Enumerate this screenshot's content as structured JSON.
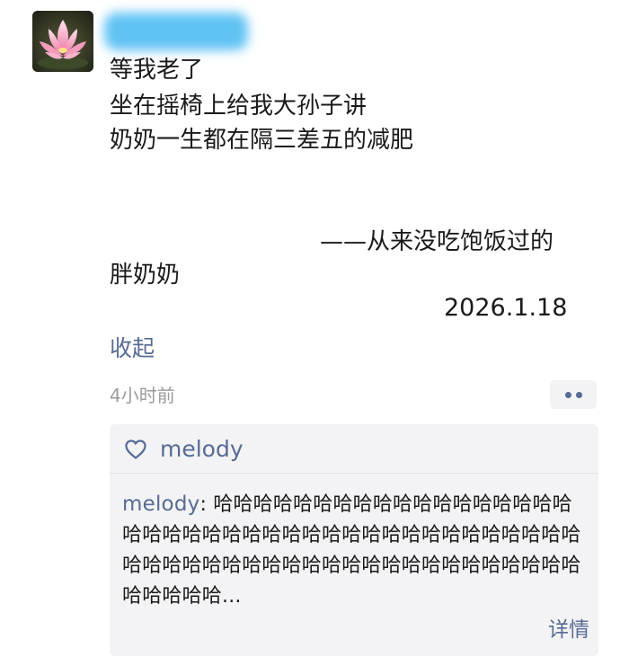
{
  "post": {
    "avatar_icon": "pink-lotus-flower",
    "username_redacted": true,
    "lines": [
      "等我老了",
      "坐在摇椅上给我大孙子讲",
      "奶奶一生都在隔三差五的减肥",
      "——从来没吃饱饭过的",
      "胖奶奶"
    ],
    "date": "2026.1.18",
    "collapse_label": "收起",
    "timestamp": "4小时前"
  },
  "more_button": {
    "icon": "two-dots-icon"
  },
  "interactions": {
    "like_icon": "heart-outline-icon",
    "liked_by": "melody",
    "comment": {
      "author": "melody",
      "separator": ": ",
      "text": "哈哈哈哈哈哈哈哈哈哈哈哈哈哈哈哈哈哈哈哈哈哈哈哈哈哈哈哈哈哈哈哈哈哈哈哈哈哈哈哈哈哈哈哈哈哈哈哈哈哈哈哈哈哈哈哈哈哈哈哈哈哈哈哈哈哈哈哈哈..."
    },
    "detail_label": "详情"
  },
  "colors": {
    "link": "#576b95",
    "meta": "#9a9a9a",
    "panel": "#f3f3f5",
    "text": "#1a1a1a"
  }
}
